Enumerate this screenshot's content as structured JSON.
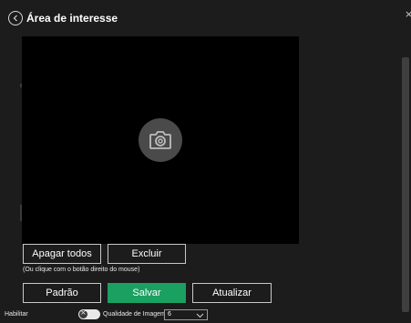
{
  "header": {
    "title": "Área de interesse",
    "close_symbol": "×"
  },
  "region_buttons": {
    "clear_all": "Apagar todos",
    "delete": "Excluir"
  },
  "hint": "(Ou clique com o botão direito do mouse)",
  "actions": {
    "default": "Padrão",
    "save": "Salvar",
    "refresh": "Atualizar"
  },
  "footer": {
    "enable_label": "Habilitar",
    "enable_toggle_on": false,
    "quality_label": "Qualidade de Imagem",
    "quality_value": "6"
  },
  "colors": {
    "accent": "#1aa060",
    "background": "#1c1c1c",
    "video": "#000000"
  }
}
